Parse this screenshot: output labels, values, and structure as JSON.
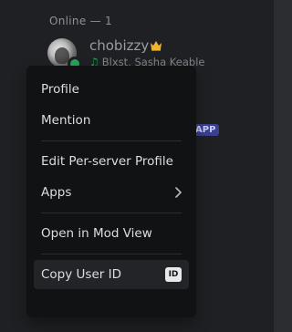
{
  "members_list": {
    "section_header": "Online — 1",
    "member": {
      "name": "chobizzy",
      "activity": "Blxst, Sasha Keable",
      "status_color": "#23a55a",
      "crown_color": "#f0b232"
    },
    "peek_badge": "APP"
  },
  "context_menu": {
    "group1": [
      {
        "label": "Profile"
      },
      {
        "label": "Mention"
      }
    ],
    "group2": [
      {
        "label": "Edit Per-server Profile"
      },
      {
        "label": "Apps"
      }
    ],
    "group3": [
      {
        "label": "Open in Mod View"
      }
    ],
    "group4": [
      {
        "label": "Copy User ID",
        "icon_text": "ID"
      }
    ]
  }
}
